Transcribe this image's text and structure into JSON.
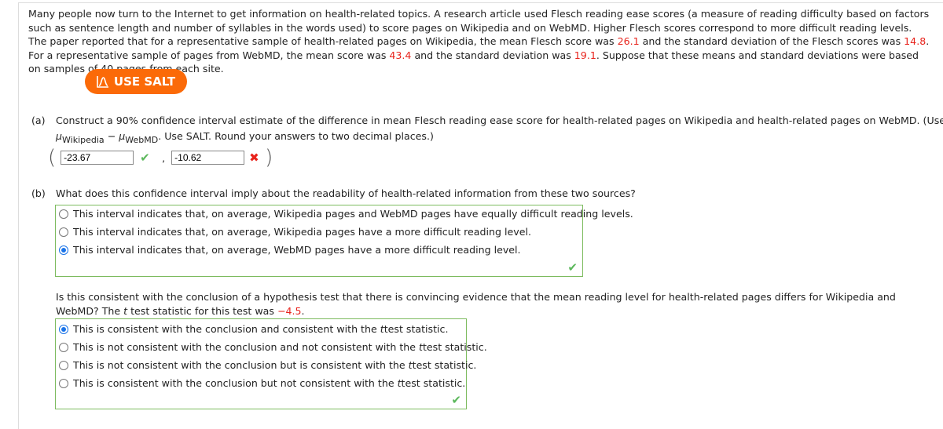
{
  "intro": {
    "p1": "Many people now turn to the Internet to get information on health-related topics. A research article used Flesch reading ease scores (a measure of reading difficulty based on factors such as sentence length and number of syllables in the words used) to score pages on Wikipedia and on WebMD. Higher Flesch scores correspond to more difficult reading levels. The paper reported that for a representative sample of health-related pages on Wikipedia, the mean Flesch score was ",
    "wiki_mean": "26.1",
    "p2": " and the standard deviation of the Flesch scores was ",
    "wiki_sd": "14.8",
    "p3": ". For a representative sample of pages from WebMD, the mean score was ",
    "webmd_mean": "43.4",
    "p4": " and the standard deviation was ",
    "webmd_sd": "19.1",
    "p5": ". Suppose that these means and standard deviations were based on samples of 40 pages from each site."
  },
  "salt_button": {
    "label": "USE SALT",
    "icon": "salt-distribution-icon"
  },
  "part_a": {
    "label": "(a)",
    "text": "Construct a 90% confidence interval estimate of the difference in mean Flesch reading ease score for health-related pages on Wikipedia and health-related pages on WebMD. (Use",
    "mu": "μ",
    "sub1": "Wikipedia",
    "minus": " − ",
    "sub2": "WebMD",
    "text2": ". Use SALT. Round your answers to two decimal places.)",
    "lower_value": "-23.67",
    "lower_status": "correct",
    "upper_value": "-10.62",
    "upper_status": "incorrect",
    "open_paren": "(",
    "close_paren": ")",
    "comma": ","
  },
  "part_b": {
    "label": "(b)",
    "question": "What does this confidence interval imply about the readability of health-related information from these two sources?",
    "options": [
      {
        "label": "This interval indicates that, on average, Wikipedia pages and WebMD pages have equally difficult reading levels.",
        "selected": false
      },
      {
        "label": "This interval indicates that, on average, Wikipedia pages have a more difficult reading level.",
        "selected": false
      },
      {
        "label": "This interval indicates that, on average, WebMD pages have a more difficult reading level.",
        "selected": true
      }
    ],
    "status": "correct"
  },
  "hypothesis": {
    "q1": "Is this consistent with the conclusion of a hypothesis test that there is convincing evidence that the mean reading level for health-related pages differs for Wikipedia and WebMD? The ",
    "t": "t",
    "q2": " test statistic for this test was ",
    "t_value": "−4.5",
    "q3": ".",
    "options": [
      {
        "pre": "This is consistent with the conclusion and consistent with the ",
        "post": " test statistic.",
        "selected": true
      },
      {
        "pre": "This is not consistent with the conclusion and not consistent with the ",
        "post": " test statistic.",
        "selected": false
      },
      {
        "pre": "This is not consistent with the conclusion but is consistent with the ",
        "post": " test statistic.",
        "selected": false
      },
      {
        "pre": "This is consistent with the conclusion but not consistent with the ",
        "post": " test statistic.",
        "selected": false
      }
    ],
    "status": "correct"
  },
  "colors": {
    "accent": "#fb6a08",
    "error": "#e8231c",
    "correct": "#5cb85c",
    "radio": "#1a73e8"
  }
}
